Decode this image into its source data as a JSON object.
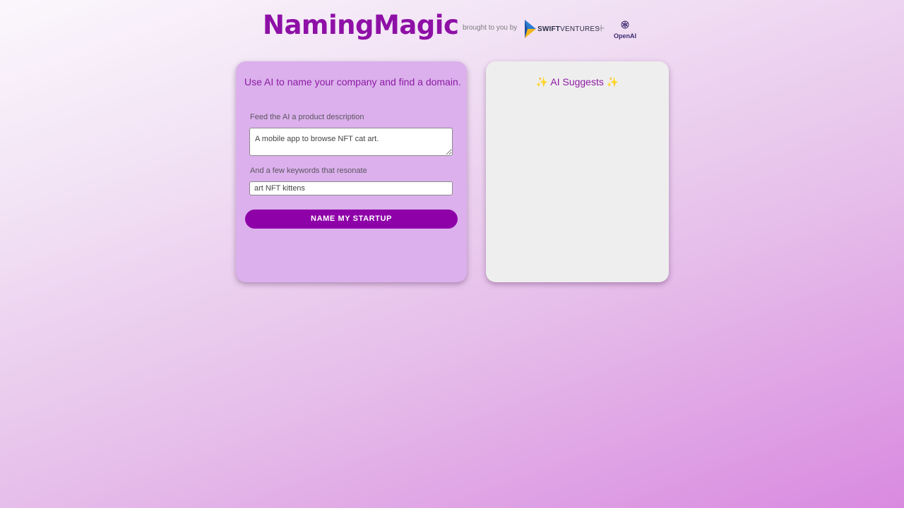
{
  "header": {
    "title": "NamingMagic",
    "brought_by": "brought to you by",
    "swift_bold": "SWIFT",
    "swift_rest": "VENTURES",
    "plus": "+",
    "openai": "OpenAI"
  },
  "form": {
    "tagline": "Use AI to name your company and find a domain.",
    "description_label": "Feed the AI a product description",
    "description_value": "A mobile app to browse NFT cat art.",
    "keywords_label": "And a few keywords that resonate",
    "keywords_value": "art NFT kittens",
    "submit_label": "NAME MY STARTUP"
  },
  "suggestions": {
    "sparkle_left": "✨",
    "title": "AI Suggests",
    "sparkle_right": "✨"
  },
  "colors": {
    "brand": "#8e10a6",
    "button": "#8e00a8",
    "left_card": "#dbb0ec",
    "right_card": "#efeeef"
  }
}
